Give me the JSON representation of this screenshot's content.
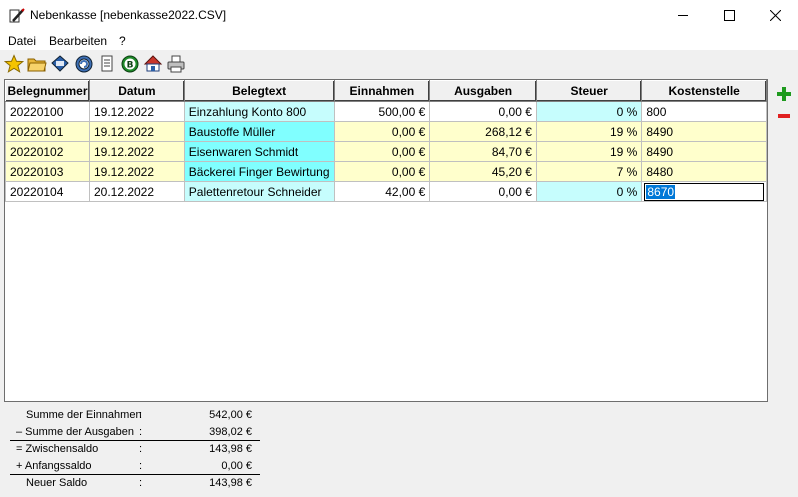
{
  "window": {
    "title": "Nebenkasse [nebenkasse2022.CSV]",
    "minimize": "—",
    "maximize": "☐",
    "close": "✕"
  },
  "menu": {
    "items": [
      "Datei",
      "Bearbeiten",
      "?"
    ]
  },
  "toolbar": {
    "icons": [
      "star-icon",
      "folder-open-icon",
      "save-icon",
      "settings-icon",
      "document-icon",
      "euro-coin-icon",
      "home-icon",
      "print-icon"
    ]
  },
  "table": {
    "headers": [
      "Belegnummer",
      "Datum",
      "Belegtext",
      "Einnahmen",
      "Ausgaben",
      "Steuer",
      "Kostenstelle"
    ],
    "rows": [
      {
        "beleg": "20220100",
        "datum": "19.12.2022",
        "text": "Einzahlung Konto 800",
        "ein": "500,00 €",
        "aus": "0,00 €",
        "steuer": "0 %",
        "kst": "800"
      },
      {
        "beleg": "20220101",
        "datum": "19.12.2022",
        "text": "Baustoffe Müller",
        "ein": "0,00 €",
        "aus": "268,12 €",
        "steuer": "19 %",
        "kst": "8490"
      },
      {
        "beleg": "20220102",
        "datum": "19.12.2022",
        "text": "Eisenwaren Schmidt",
        "ein": "0,00 €",
        "aus": "84,70 €",
        "steuer": "19 %",
        "kst": "8490"
      },
      {
        "beleg": "20220103",
        "datum": "19.12.2022",
        "text": "Bäckerei Finger Bewirtung",
        "ein": "0,00 €",
        "aus": "45,20 €",
        "steuer": "7 %",
        "kst": "8480"
      },
      {
        "beleg": "20220104",
        "datum": "20.12.2022",
        "text": "Palettenretour Schneider",
        "ein": "42,00 €",
        "aus": "0,00 €",
        "steuer": "0 %",
        "kst": "8670"
      }
    ]
  },
  "side": {
    "add": "+",
    "remove": "−"
  },
  "summary": [
    {
      "label": "Summe der Einnahmen",
      "colon": ":",
      "value": "542,00 €"
    },
    {
      "label": "–  Summe der Ausgaben",
      "colon": ":",
      "value": "398,02 €"
    },
    {
      "label": "= Zwischensaldo",
      "colon": ":",
      "value": "143,98 €"
    },
    {
      "label": "+ Anfangssaldo",
      "colon": ":",
      "value": "0,00 €"
    },
    {
      "label": "Neuer Saldo",
      "colon": ":",
      "value": "143,98 €"
    }
  ],
  "colors": {
    "highlight": "#ffffcc",
    "cyan": "#80ffff",
    "light_cyan": "#c6fdfd",
    "selection": "#0078d7",
    "add_green": "#1e9a1e",
    "remove_red": "#e02020"
  }
}
